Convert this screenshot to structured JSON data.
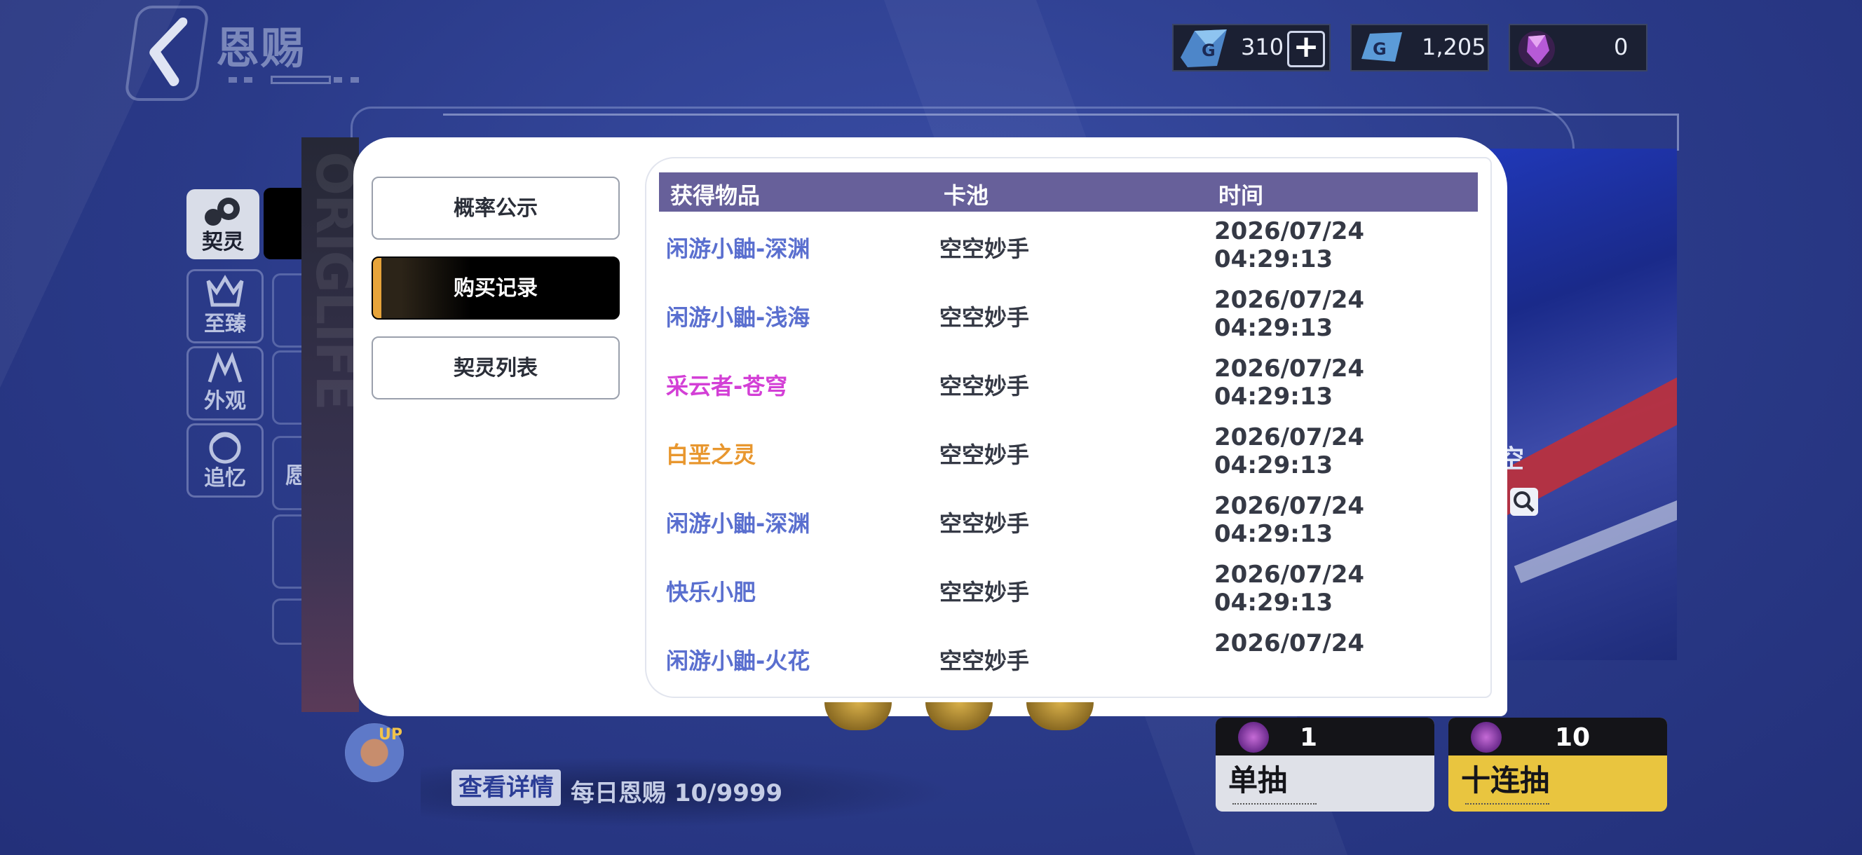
{
  "header": {
    "title": "恩赐"
  },
  "currencies": [
    {
      "icon": "blue-crystal-icon",
      "value": "310"
    },
    {
      "icon": "ticket-icon",
      "value": "1,205"
    },
    {
      "icon": "purple-gem-icon",
      "value": "0"
    }
  ],
  "sidebar": {
    "items": [
      {
        "label": "契灵",
        "icon": "spirit-icon"
      },
      {
        "label": "至臻",
        "icon": "crown-icon"
      },
      {
        "label": "外观",
        "icon": "costume-icon"
      },
      {
        "label": "追忆",
        "icon": "memory-icon"
      }
    ],
    "partial_labels": [
      "愿"
    ]
  },
  "banner": {
    "partial_text": "空"
  },
  "modal": {
    "tabs": [
      {
        "label": "概率公示",
        "active": false
      },
      {
        "label": "购买记录",
        "active": true
      },
      {
        "label": "契灵列表",
        "active": false
      }
    ],
    "table": {
      "headers": [
        "获得物品",
        "卡池",
        "时间"
      ],
      "rows": [
        {
          "item": "闲游小鼬-深渊",
          "pool": "空空妙手",
          "date": "2026/07/24",
          "time": "04:29:13",
          "color": "#5a6fcf"
        },
        {
          "item": "闲游小鼬-浅海",
          "pool": "空空妙手",
          "date": "2026/07/24",
          "time": "04:29:13",
          "color": "#5a6fcf"
        },
        {
          "item": "采云者-苍穹",
          "pool": "空空妙手",
          "date": "2026/07/24",
          "time": "04:29:13",
          "color": "#d33fd6"
        },
        {
          "item": "白垩之灵",
          "pool": "空空妙手",
          "date": "2026/07/24",
          "time": "04:29:13",
          "color": "#e8972f"
        },
        {
          "item": "闲游小鼬-深渊",
          "pool": "空空妙手",
          "date": "2026/07/24",
          "time": "04:29:13",
          "color": "#5a6fcf"
        },
        {
          "item": "快乐小肥",
          "pool": "空空妙手",
          "date": "2026/07/24",
          "time": "04:29:13",
          "color": "#5a6fcf"
        },
        {
          "item": "闲游小鼬-火花",
          "pool": "空空妙手",
          "date": "2026/07/24",
          "time": "",
          "color": "#5a6fcf"
        }
      ]
    }
  },
  "bottom": {
    "up_badge": "UP",
    "detail_button": "查看详情",
    "daily_text": "每日恩赐 10/9999",
    "single_draw": {
      "label": "单抽",
      "cost": "1"
    },
    "ten_draw": {
      "label": "十连抽",
      "cost": "10"
    }
  }
}
